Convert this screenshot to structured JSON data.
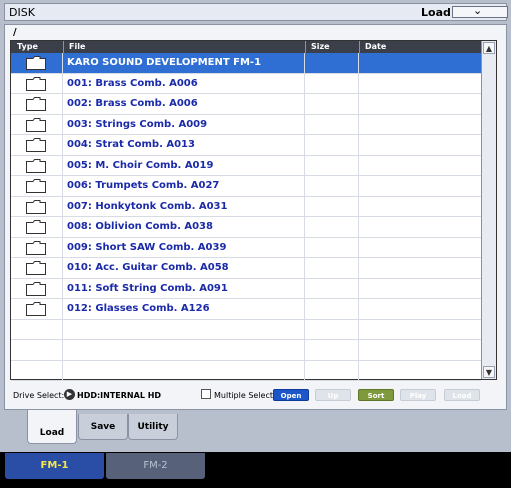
{
  "window": {
    "title": "DISK",
    "page_label": "Load",
    "page_menu_icon": "chevron-down-icon",
    "path": "/"
  },
  "table": {
    "columns": [
      "Type",
      "File",
      "Size",
      "Date"
    ],
    "rows": [
      {
        "type": "folder",
        "file": "KARO SOUND DEVELOPMENT FM-1",
        "selected": true
      },
      {
        "type": "folder",
        "file": "001: Brass Comb. A006"
      },
      {
        "type": "folder",
        "file": "002: Brass Comb. A006"
      },
      {
        "type": "folder",
        "file": "003: Strings Comb. A009"
      },
      {
        "type": "folder",
        "file": "004: Strat Comb. A013"
      },
      {
        "type": "folder",
        "file": "005: M. Choir Comb. A019"
      },
      {
        "type": "folder",
        "file": "006: Trumpets Comb. A027"
      },
      {
        "type": "folder",
        "file": "007: Honkytonk Comb. A031"
      },
      {
        "type": "folder",
        "file": "008: Oblivion Comb. A038"
      },
      {
        "type": "folder",
        "file": "009: Short SAW Comb. A039"
      },
      {
        "type": "folder",
        "file": "010: Acc. Guitar Comb. A058"
      },
      {
        "type": "folder",
        "file": "011: Soft String Comb. A091"
      },
      {
        "type": "folder",
        "file": "012: Glasses Comb. A126"
      },
      {
        "type": "",
        "file": ""
      },
      {
        "type": "",
        "file": ""
      },
      {
        "type": "",
        "file": ""
      }
    ]
  },
  "bottom": {
    "drive_label": "Drive Select:",
    "drive_value": "HDD:INTERNAL HD",
    "multiple_select_label": "Multiple Select",
    "buttons": {
      "open": "Open",
      "up": "Up",
      "sort": "Sort",
      "play": "Play",
      "load": "Load"
    }
  },
  "tabs": [
    "Load",
    "Save",
    "Utility"
  ],
  "footer_tabs": [
    "FM-1",
    "FM-2"
  ],
  "colors": {
    "selection": "#2f6fd3",
    "file_text": "#1a2aa8",
    "fm1_text": "#f4e84a"
  }
}
